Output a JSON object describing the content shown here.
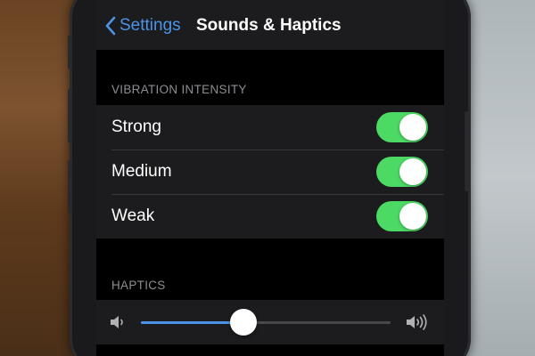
{
  "navbar": {
    "back_label": "Settings",
    "title": "Sounds & Haptics"
  },
  "vibration": {
    "header": "VIBRATION INTENSITY",
    "items": [
      {
        "label": "Strong",
        "on": true
      },
      {
        "label": "Medium",
        "on": true
      },
      {
        "label": "Weak",
        "on": true
      }
    ]
  },
  "haptics": {
    "header": "HAPTICS",
    "slider_level": 0.41,
    "low_icon": "speaker-low-icon",
    "high_icon": "speaker-high-icon"
  },
  "colors": {
    "accent": "#4b93e6",
    "toggle_on": "#4cd964",
    "screen_bg": "#000000",
    "group_bg": "#1c1c1e",
    "header_text": "#8e8e93"
  }
}
